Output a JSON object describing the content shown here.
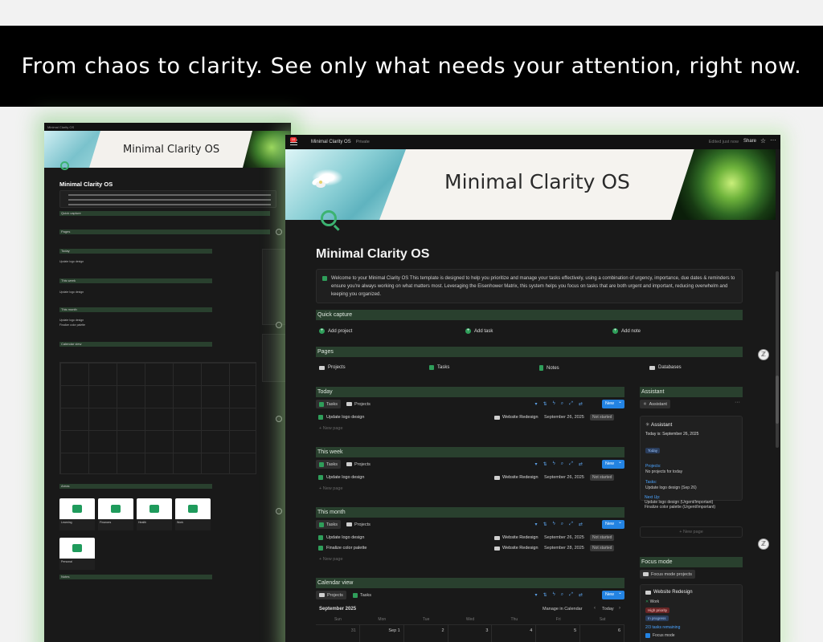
{
  "banner": "From chaos to clarity. See only what needs your attention, right now.",
  "window": {
    "breadcrumb": "Minimal Clarity OS",
    "visibility": "Private",
    "edited": "Edited just now",
    "share": "Share",
    "notification_count": "10"
  },
  "cover_title": "Minimal Clarity OS",
  "page_title": "Minimal Clarity OS",
  "intro": "Welcome to your Minimal Clarity OS This template is designed to help you prioritize and manage your tasks effectively, using a combination of urgency, importance, due dates & reminders to ensure you're always working on what matters most. Leveraging the Eisenhower Matrix, this system helps you focus on tasks that are both urgent and important, reducing overwhelm and keeping you organized.",
  "quick_capture": {
    "title": "Quick capture",
    "items": [
      "Add project",
      "Add task",
      "Add note"
    ]
  },
  "pages": {
    "title": "Pages",
    "items": [
      "Projects",
      "Tasks",
      "Notes",
      "Databases"
    ]
  },
  "views": {
    "tab_tasks": "Tasks",
    "tab_projects": "Projects",
    "new": "New",
    "new_page": "New page"
  },
  "today": {
    "title": "Today",
    "rows": [
      {
        "name": "Update logo design",
        "project": "Website Redesign",
        "date": "September 26, 2025",
        "status": "Not started"
      }
    ]
  },
  "this_week": {
    "title": "This week",
    "rows": [
      {
        "name": "Update logo design",
        "project": "Website Redesign",
        "date": "September 26, 2025",
        "status": "Not started"
      }
    ]
  },
  "this_month": {
    "title": "This month",
    "rows": [
      {
        "name": "Update logo design",
        "project": "Website Redesign",
        "date": "September 26, 2025",
        "status": "Not started"
      },
      {
        "name": "Finalize color palette",
        "project": "Website Redesign",
        "date": "September 28, 2025",
        "status": "Not started"
      }
    ]
  },
  "calendar": {
    "title": "Calendar view",
    "tab_projects": "Projects",
    "tab_tasks": "Tasks",
    "month": "September 2025",
    "manage": "Manage in Calendar",
    "today": "Today",
    "days": [
      "Sun",
      "Mon",
      "Tue",
      "Wed",
      "Thu",
      "Fri",
      "Sat"
    ],
    "first_row": [
      "31",
      "Sep 1",
      "2",
      "3",
      "4",
      "5",
      "6"
    ]
  },
  "assistant": {
    "title": "Assistant",
    "tab": "Assistant",
    "header": "Assistant",
    "today_is": "Today is: September 26, 2025",
    "today_chip": "Today",
    "projects_label": "Projects:",
    "projects_value": "No projects for today",
    "tasks_label": "Tasks:",
    "tasks_value": "Update logo design (Sep 26)",
    "next_label": "Next Up:",
    "next_1": "Update logo design (Urgent/Important)",
    "next_2": "Finalize color palette (Urgent/Important)",
    "new_page": "New page"
  },
  "focus": {
    "title": "Focus mode",
    "tab": "Focus mode projects",
    "project": "Website Redesign",
    "area": "Work",
    "priority": "High priority",
    "status": "In progress",
    "remaining": "2/3 tasks remaining",
    "focus_mode": "Focus mode"
  },
  "mini": {
    "title": "Minimal Clarity OS",
    "sections": [
      "Quick capture",
      "Pages",
      "Today",
      "This week",
      "This month",
      "Calendar view",
      "Areas",
      "Notes"
    ],
    "areas": [
      "Learning",
      "Finances",
      "Health",
      "Work",
      "Personal"
    ]
  },
  "colors": {
    "banner_bg": "#000000",
    "section_bg": "#29402e",
    "accent_green": "#2f9e5a",
    "new_button": "#2383e2",
    "glow": "#aae696"
  }
}
